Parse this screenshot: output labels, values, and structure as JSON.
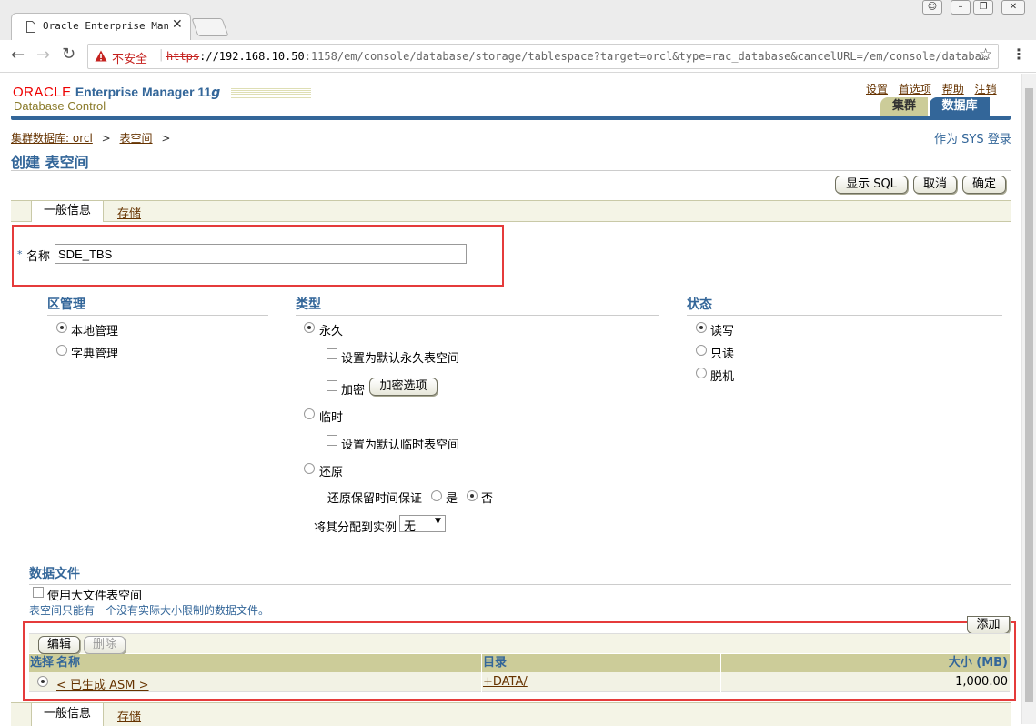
{
  "browser": {
    "tab_title": "Oracle Enterprise Mana",
    "security_label": "不安全",
    "url_scheme": "https",
    "url_host": "://192.168.10.50",
    "url_rest": ":1158/em/console/database/storage/tablespace?target=orcl&type=rac_database&cancelURL=/em/console/databa…"
  },
  "header": {
    "logo_oracle": "ORACLE",
    "logo_em": "Enterprise Manager 11",
    "logo_g": "g",
    "subtitle": "Database Control",
    "links": [
      "设置",
      "首选项",
      "帮助",
      "注销"
    ],
    "tabs": [
      "集群",
      "数据库"
    ]
  },
  "breadcrumb": {
    "item1": "集群数据库: orcl",
    "sep1": ">",
    "item2": "表空间",
    "sep2": ">"
  },
  "login_info": "作为 SYS 登录",
  "page_title": "创建 表空间",
  "actions": {
    "show_sql": "显示 SQL",
    "cancel": "取消",
    "ok": "确定"
  },
  "subtabs": [
    "一般信息",
    "存储"
  ],
  "name_field": {
    "required": "*",
    "label": "名称",
    "value": "SDE_TBS"
  },
  "extent_mgmt": {
    "title": "区管理",
    "options": [
      "本地管理",
      "字典管理"
    ],
    "selected": "本地管理"
  },
  "type": {
    "title": "类型",
    "permanent": "永久",
    "default_permanent": "设置为默认永久表空间",
    "encrypt": "加密",
    "encrypt_options_btn": "加密选项",
    "temporary": "临时",
    "default_temporary": "设置为默认临时表空间",
    "undo": "还原",
    "undo_retention_label": "还原保留时间保证",
    "undo_yes": "是",
    "undo_no": "否",
    "assign_instance_label": "将其分配到实例",
    "assign_instance_value": "无"
  },
  "status": {
    "title": "状态",
    "options": [
      "读写",
      "只读",
      "脱机"
    ],
    "selected": "读写"
  },
  "datafiles": {
    "title": "数据文件",
    "bigfile_label": "使用大文件表空间",
    "bigfile_hint": "表空间只能有一个没有实际大小限制的数据文件。",
    "add_btn": "添加",
    "edit_btn": "编辑",
    "delete_btn": "删除",
    "columns": [
      "选择",
      "名称",
      "目录",
      "大小 (MB)"
    ],
    "rows": [
      {
        "name": "< 已生成 ASM >",
        "dir": "+DATA/",
        "size": "1,000.00"
      }
    ]
  }
}
